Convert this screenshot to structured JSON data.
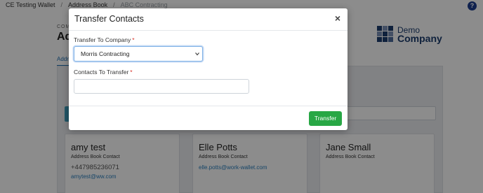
{
  "breadcrumb": {
    "items": [
      "CE Testing Wallet",
      "Address Book",
      "ABC Contracting"
    ],
    "separator": "/"
  },
  "help_icon_glyph": "?",
  "page": {
    "company_label": "COMP",
    "title": "Ad",
    "tab_label": "Addr"
  },
  "logo": {
    "line1": "Demo",
    "line2": "Company"
  },
  "contacts": [
    {
      "name": "amy test",
      "role": "Address Book Contact",
      "phone": "+447985236071",
      "email": "amytest@ww.com"
    },
    {
      "name": "Elle Potts",
      "role": "Address Book Contact",
      "phone": "",
      "email": "elle.potts@work-wallet.com"
    },
    {
      "name": "Jane Small",
      "role": "Address Book Contact",
      "phone": "",
      "email": ""
    }
  ],
  "modal": {
    "title": "Transfer Contacts",
    "close_glyph": "×",
    "company_field": {
      "label": "Transfer To Company",
      "required_mark": "*",
      "value": "Morris Contracting"
    },
    "contacts_field": {
      "label": "Contacts To Transfer",
      "required_mark": "*",
      "value": ""
    },
    "transfer_button": "Transfer"
  },
  "colors": {
    "accent": "#1f6fb2",
    "transfer_button": "#28a745",
    "required": "#d9342b",
    "brand": "#1c3d6e"
  }
}
